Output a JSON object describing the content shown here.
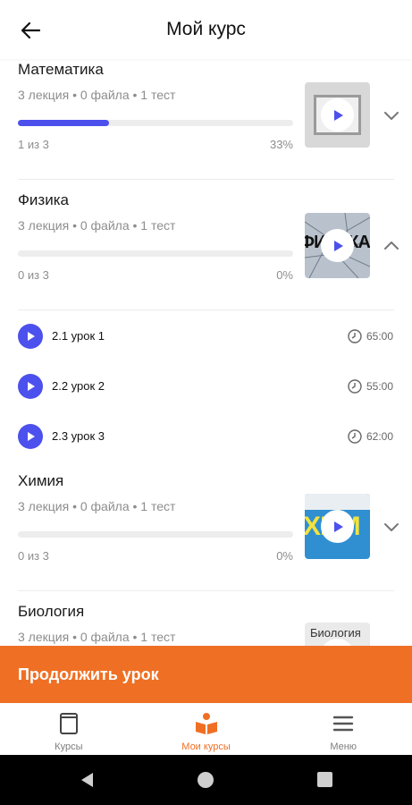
{
  "header": {
    "title": "Мой курс"
  },
  "courses": [
    {
      "name": "Математика",
      "meta": "3 лекция • 0 файла • 1 тест",
      "progress_text": "1 из 3",
      "percent": "33%",
      "progress": 0.33
    },
    {
      "name": "Физика",
      "meta": "3 лекция • 0 файла • 1 тест",
      "progress_text": "0 из 3",
      "percent": "0%",
      "progress": 0
    },
    {
      "name": "Химия",
      "meta": "3 лекция • 0 файла • 1 тест",
      "progress_text": "0 из 3",
      "percent": "0%",
      "progress": 0
    },
    {
      "name": "Биология",
      "meta": "3 лекция • 0 файла • 1 тест"
    }
  ],
  "thumb_texts": {
    "physics": "ФИЗИКА",
    "chemistry": "ХИМ",
    "biology": "Биология"
  },
  "lessons": [
    {
      "name": "2.1 урок 1",
      "duration": "65:00"
    },
    {
      "name": "2.2 урок 2",
      "duration": "55:00"
    },
    {
      "name": "2.3 урок 3",
      "duration": "62:00"
    }
  ],
  "continue_button": "Продолжить урок",
  "bottom_nav": [
    {
      "label": "Курсы",
      "icon": "book-icon"
    },
    {
      "label": "Мои курсы",
      "icon": "reading-icon"
    },
    {
      "label": "Меню",
      "icon": "menu-icon"
    }
  ],
  "colors": {
    "accent": "#4c50ec",
    "brand": "#ef7024"
  }
}
